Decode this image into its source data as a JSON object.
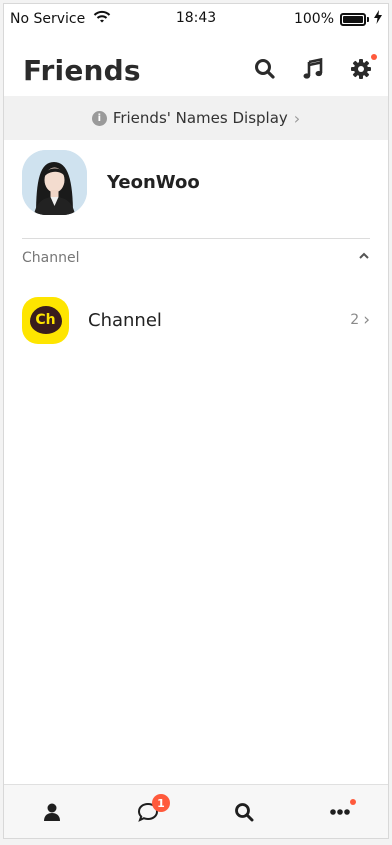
{
  "status_bar": {
    "carrier": "No Service",
    "time": "18:43",
    "battery": "100%"
  },
  "header": {
    "title": "Friends",
    "icons": [
      "search-icon",
      "music-icon",
      "gear-icon"
    ],
    "notification_dot_color": "#ff5a3c"
  },
  "banner": {
    "text": "Friends' Names Display",
    "chevron": "›"
  },
  "profile": {
    "name": "YeonWoo"
  },
  "section": {
    "label": "Channel",
    "caret": "^"
  },
  "channel": {
    "logo_text": "Ch",
    "label": "Channel",
    "count": "2",
    "chevron": "›",
    "logo_color": "#fee500"
  },
  "tabbar": {
    "items": [
      "friends-tab",
      "chats-tab",
      "search-tab",
      "more-tab"
    ],
    "chats_badge": "1"
  }
}
